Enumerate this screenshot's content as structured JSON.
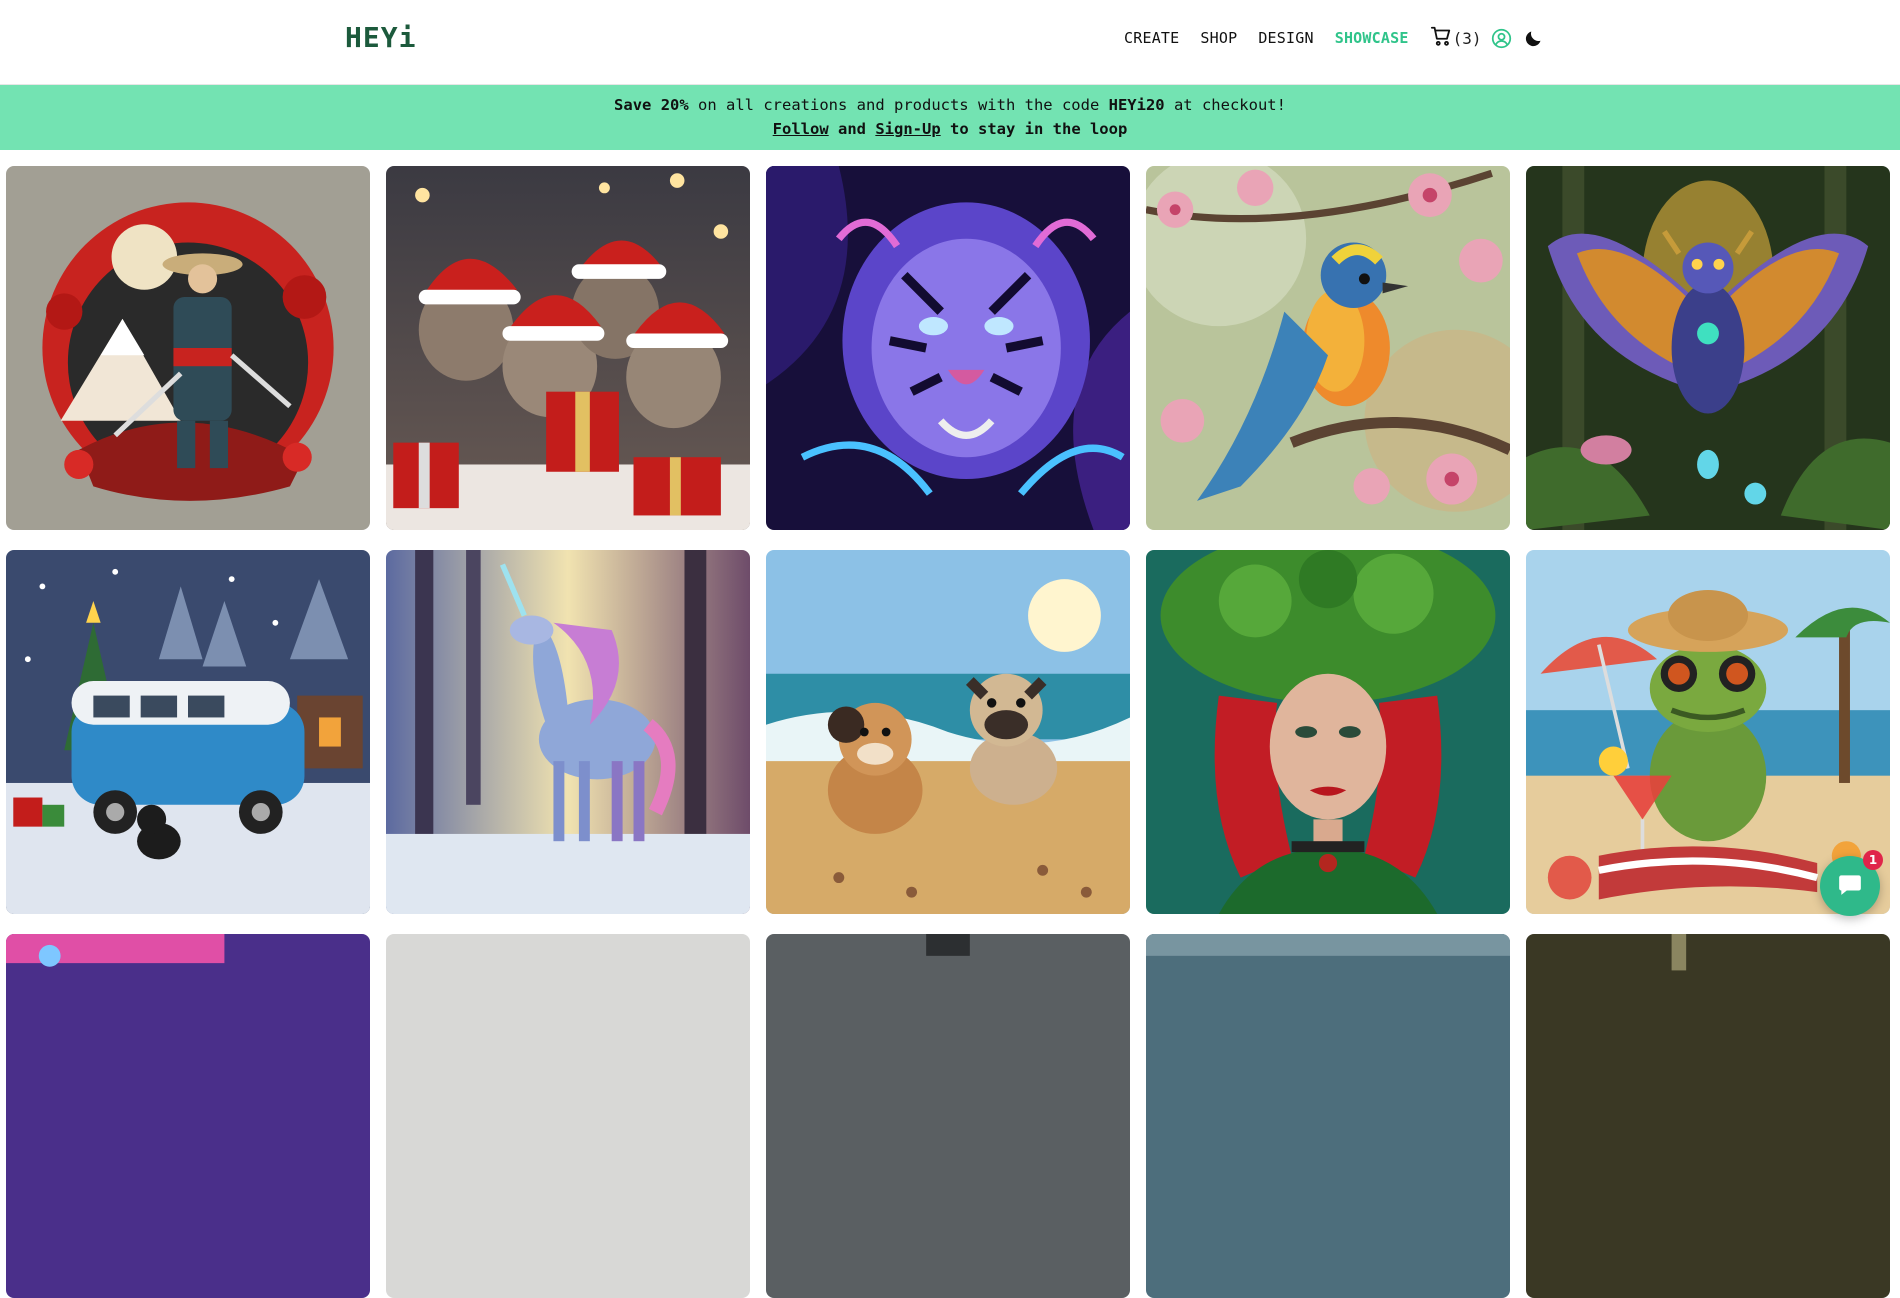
{
  "header": {
    "logo": "HEYi",
    "nav": [
      "CREATE",
      "SHOP",
      "DESIGN",
      "SHOWCASE"
    ],
    "active_nav": "SHOWCASE",
    "cart_count": "(3)",
    "icons": [
      "cart-icon",
      "user-circle-icon",
      "moon-icon"
    ]
  },
  "banner": {
    "line1_prefix": "",
    "line1_bold_1": "Save 20%",
    "line1_mid": " on all creations and products with the code ",
    "line1_bold_2": "HEYi20",
    "line1_suffix": " at checkout!",
    "line2_link_1": "Follow",
    "line2_and": " and ",
    "line2_link_2": "Sign-Up",
    "line2_suffix": " to stay in the loop"
  },
  "gallery": {
    "items": [
      "samurai-artwork",
      "christmas-kittens-artwork",
      "neon-tiger-artwork",
      "songbird-blossoms-artwork",
      "mystic-owl-artwork",
      "winter-van-dog-artwork",
      "forest-unicorn-artwork",
      "beach-puppies-artwork",
      "red-haired-woman-artwork",
      "cocktail-frog-artwork"
    ]
  },
  "chat": {
    "badge": "1"
  },
  "colors": {
    "accent": "#2fc48a",
    "banner_bg": "#73e3b2",
    "logo": "#1c5a3c"
  }
}
